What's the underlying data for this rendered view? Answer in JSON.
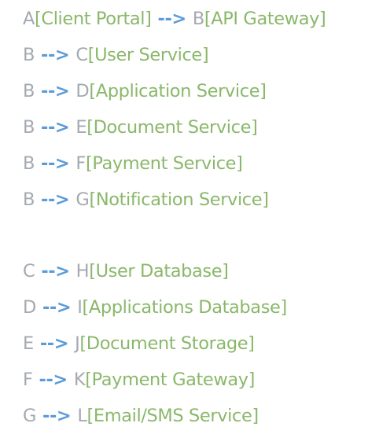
{
  "colors": {
    "node_id": "#a4a9b1",
    "arrow": "#5b9bd8",
    "label": "#8ab86a",
    "background": "#ffffff"
  },
  "lines": [
    {
      "from": "A",
      "from_label": "[Client Portal]",
      "arrow": "-->",
      "to": "B",
      "to_label": "[API Gateway]"
    },
    {
      "from": "B",
      "from_label": "",
      "arrow": "-->",
      "to": "C",
      "to_label": "[User Service]"
    },
    {
      "from": "B",
      "from_label": "",
      "arrow": "-->",
      "to": "D",
      "to_label": "[Application Service]"
    },
    {
      "from": "B",
      "from_label": "",
      "arrow": "-->",
      "to": "E",
      "to_label": "[Document Service]"
    },
    {
      "from": "B",
      "from_label": "",
      "arrow": "-->",
      "to": "F",
      "to_label": "[Payment Service]"
    },
    {
      "from": "B",
      "from_label": "",
      "arrow": "-->",
      "to": "G",
      "to_label": "[Notification Service]"
    },
    {
      "blank": true
    },
    {
      "from": "C",
      "from_label": "",
      "arrow": "-->",
      "to": "H",
      "to_label": "[User Database]"
    },
    {
      "from": "D",
      "from_label": "",
      "arrow": "-->",
      "to": "I",
      "to_label": "[Applications Database]"
    },
    {
      "from": "E",
      "from_label": "",
      "arrow": "-->",
      "to": "J",
      "to_label": "[Document Storage]"
    },
    {
      "from": "F",
      "from_label": "",
      "arrow": "-->",
      "to": "K",
      "to_label": "[Payment Gateway]"
    },
    {
      "from": "G",
      "from_label": "",
      "arrow": "-->",
      "to": "L",
      "to_label": "[Email/SMS Service]"
    }
  ]
}
